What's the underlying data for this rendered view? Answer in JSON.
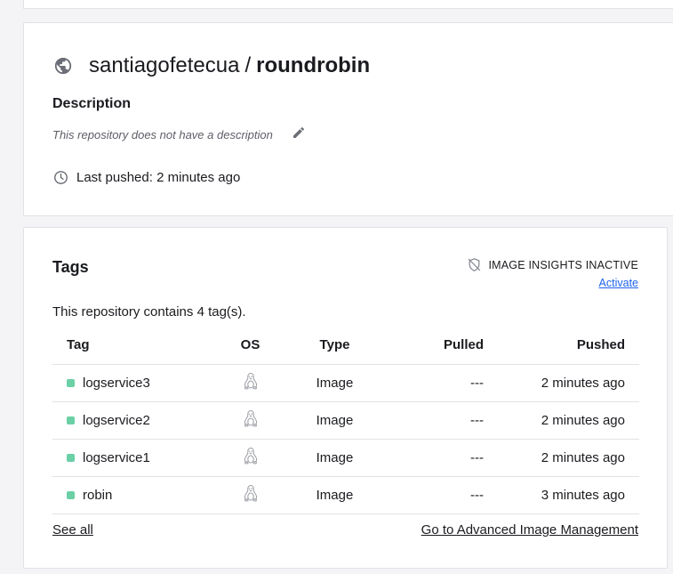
{
  "repository": {
    "namespace": "santiagofetecua",
    "separator": "/",
    "name": "roundrobin",
    "description_heading": "Description",
    "description": "This repository does not have a description",
    "last_pushed": "Last pushed: 2 minutes ago"
  },
  "tags_section": {
    "heading": "Tags",
    "insights_status": "IMAGE INSIGHTS INACTIVE",
    "activate_label": "Activate",
    "count_text": "This repository contains 4 tag(s).",
    "columns": [
      "Tag",
      "OS",
      "Type",
      "Pulled",
      "Pushed"
    ],
    "rows": [
      {
        "tag": "logservice3",
        "os_icon": "linux-icon",
        "type": "Image",
        "pulled": "---",
        "pushed": "2 minutes ago"
      },
      {
        "tag": "logservice2",
        "os_icon": "linux-icon",
        "type": "Image",
        "pulled": "---",
        "pushed": "2 minutes ago"
      },
      {
        "tag": "logservice1",
        "os_icon": "linux-icon",
        "type": "Image",
        "pulled": "---",
        "pushed": "2 minutes ago"
      },
      {
        "tag": "robin",
        "os_icon": "linux-icon",
        "type": "Image",
        "pulled": "---",
        "pushed": "3 minutes ago"
      }
    ],
    "see_all_label": "See all",
    "advanced_label": "Go to Advanced Image Management"
  },
  "colors": {
    "tag_status": "#6bd0a6",
    "link": "#1d63ed"
  }
}
